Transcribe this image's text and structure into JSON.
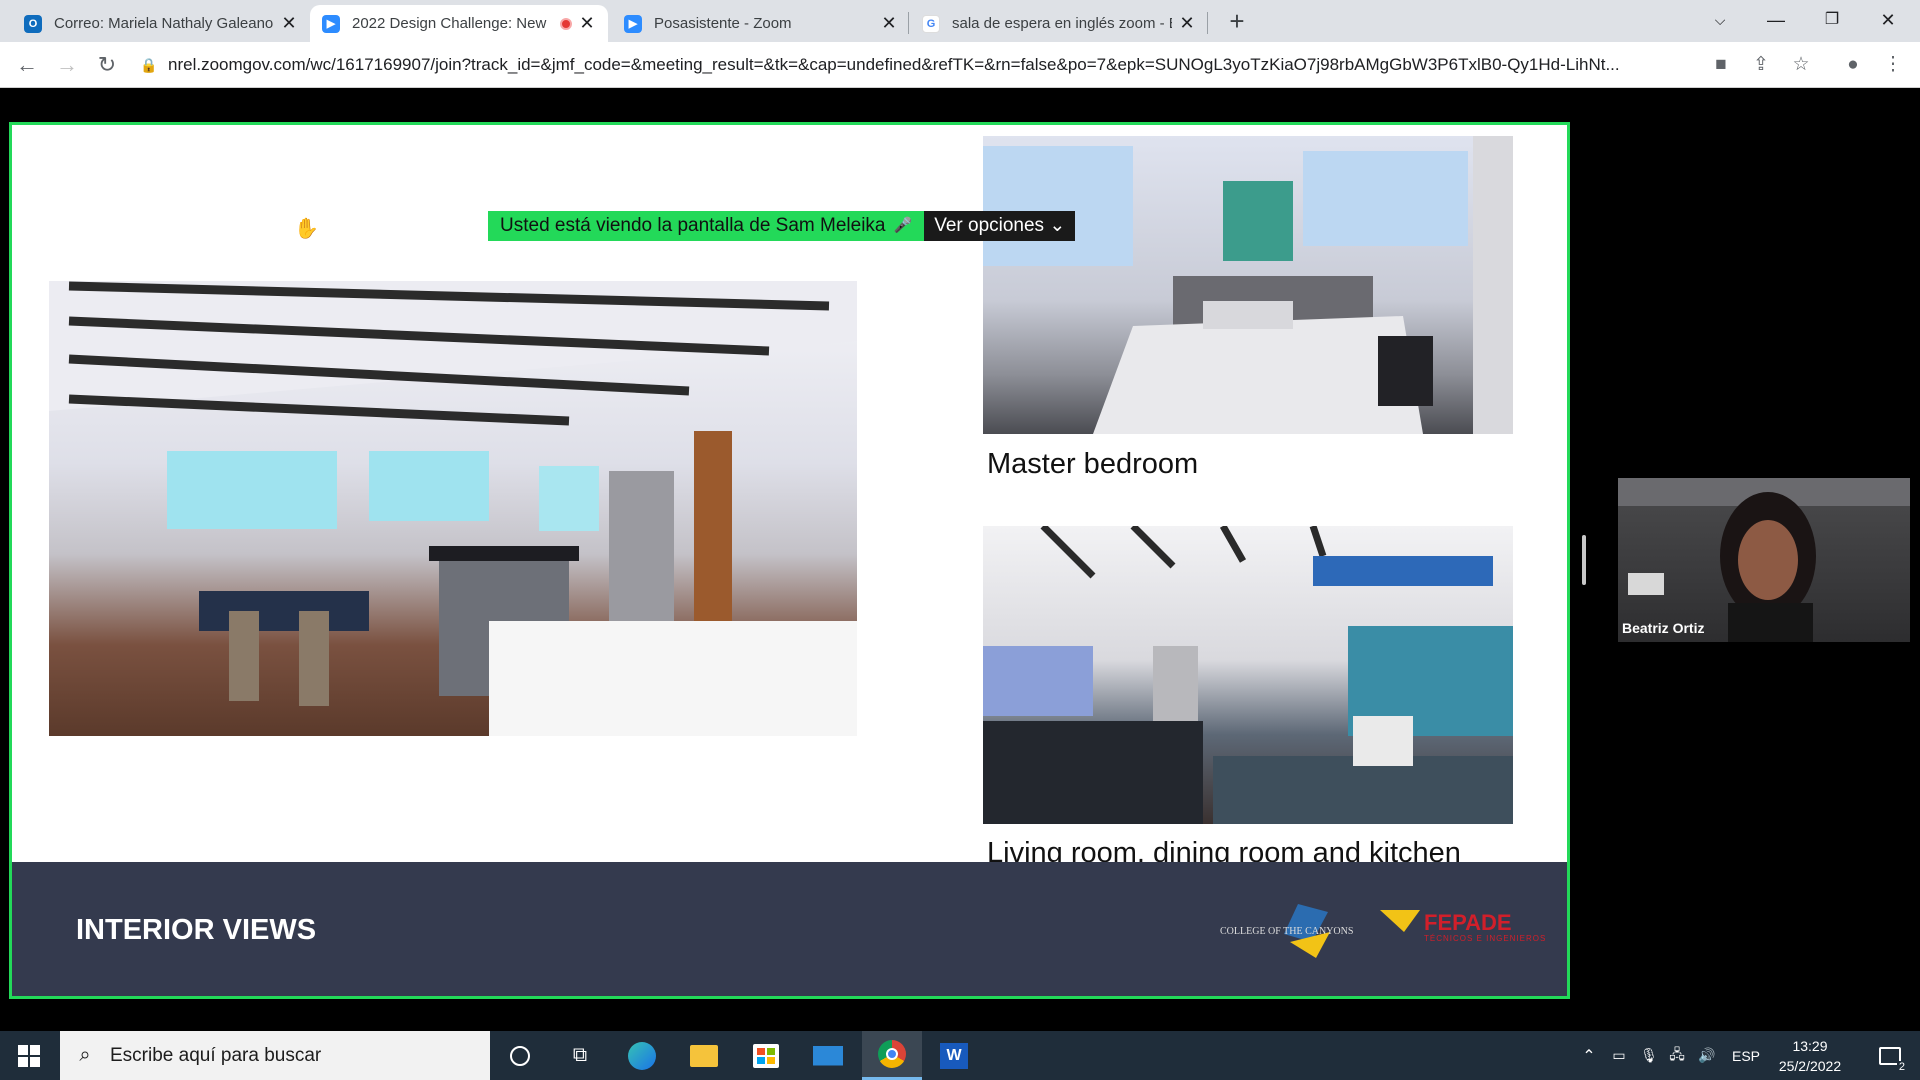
{
  "browser": {
    "tabs": [
      {
        "title": "Correo: Mariela Nathaly Galeano",
        "favicon": "outlook-icon",
        "color": "#0f6cbd"
      },
      {
        "title": "2022 Design Challenge: New",
        "favicon": "zoom-icon",
        "color": "#2d8cff"
      },
      {
        "title": "Posasistente - Zoom",
        "favicon": "zoom-icon",
        "color": "#2d8cff"
      },
      {
        "title": "sala de espera en inglés zoom - B",
        "favicon": "google-icon",
        "color": "#ffffff"
      }
    ],
    "url": "nrel.zoomgov.com/wc/1617169907/join?track_id=&jmf_code=&meeting_result=&tk=&cap=undefined&refTK=&rn=false&po=7&epk=SUNOgL3yoTzKiaO7j98rbAMgGbW3P6TxlB0-Qy1Hd-LihNt..."
  },
  "meeting": {
    "banner_text": "Usted está viendo la pantalla de Sam Meleika",
    "options_label": "Ver opciones",
    "participant_name": "Beatriz Ortiz",
    "share_border_color": "#23d959"
  },
  "slide": {
    "caption_bedroom": "Master bedroom",
    "caption_living": "Living room, dining room and kitchen",
    "footer_title": "INTERIOR VIEWS",
    "logo_1": "COLLEGE OF THE CANYONS",
    "logo_2": "FEPADE",
    "logo_2_sub": "TÉCNICOS E INGENIEROS",
    "footer_color": "#343a4e"
  },
  "taskbar": {
    "search_placeholder": "Escribe aquí para buscar",
    "language": "ESP",
    "time": "13:29",
    "date": "25/2/2022",
    "notification_count": "2"
  }
}
